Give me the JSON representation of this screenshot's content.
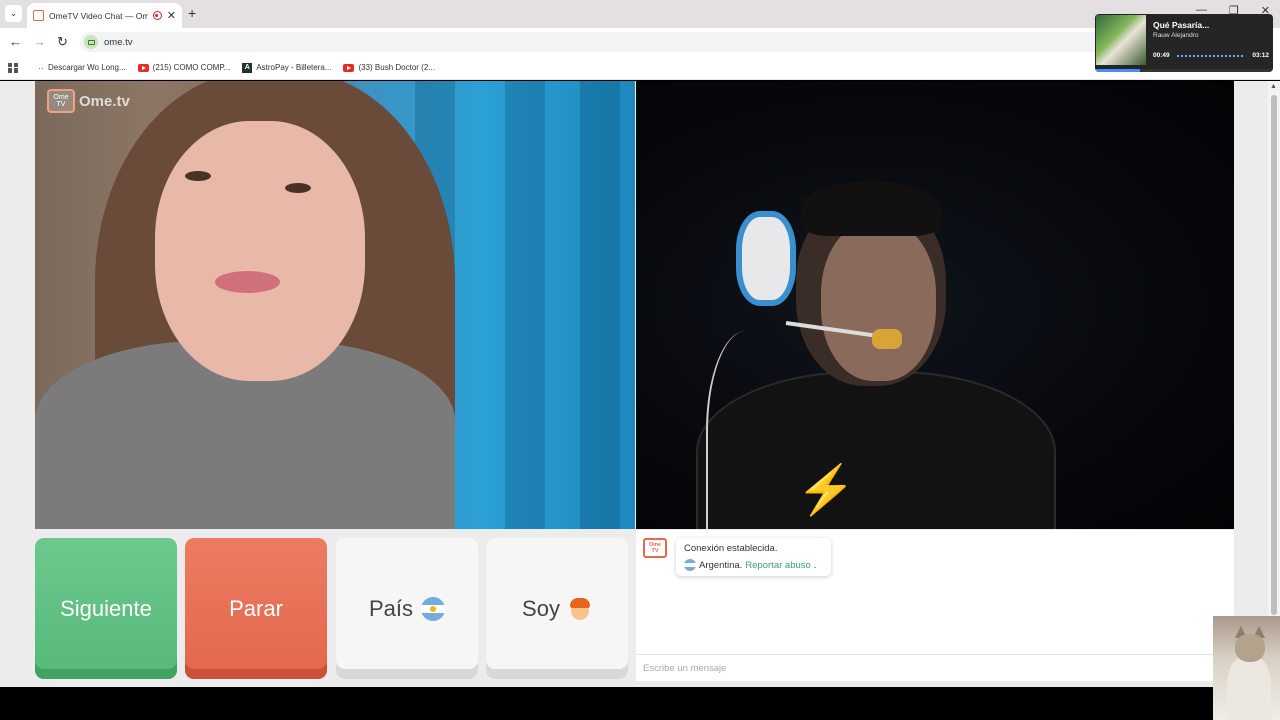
{
  "browser": {
    "tab_title": "OmeTV Video Chat — Omegle",
    "url": "ome.tv",
    "bookmarks": [
      "Descargar Wo Long...",
      "(215) COMO COMP...",
      "AstroPay - Billetera...",
      "(33) Bush Doctor (2..."
    ],
    "icons": {
      "back": "arrow-left",
      "forward": "arrow-right",
      "reload": "reload",
      "new_tab": "plus",
      "close_tab": "x"
    },
    "glyphs": {
      "menu": "⌄",
      "close": "✕",
      "plus": "+",
      "back": "←",
      "forward": "→",
      "reload": "↻",
      "minimize": "—",
      "maximize": "❐",
      "window_close": "✕",
      "scroll_up": "▲"
    }
  },
  "media": {
    "title": "Qué Pasaría...",
    "artist": "Rauw Alejandro",
    "current_time": "00:49",
    "total_time": "03:12",
    "progress": 0.25
  },
  "app": {
    "brand": "Ome.tv",
    "brand_icon_text": "Ome TV",
    "buttons": {
      "next": "Siguiente",
      "stop": "Parar",
      "country": "País",
      "gender": "Soy"
    },
    "chat": {
      "status": "Conexión establecida.",
      "country": "Argentina.",
      "report": "Reportar abuso",
      "report_suffix": ".",
      "placeholder": "Escribe un mensaje"
    },
    "colors": {
      "next": "#56b87a",
      "stop": "#e2674b",
      "link": "#3aa36e",
      "brand": "#e8664a"
    },
    "shirt_glyph": "⚡"
  }
}
